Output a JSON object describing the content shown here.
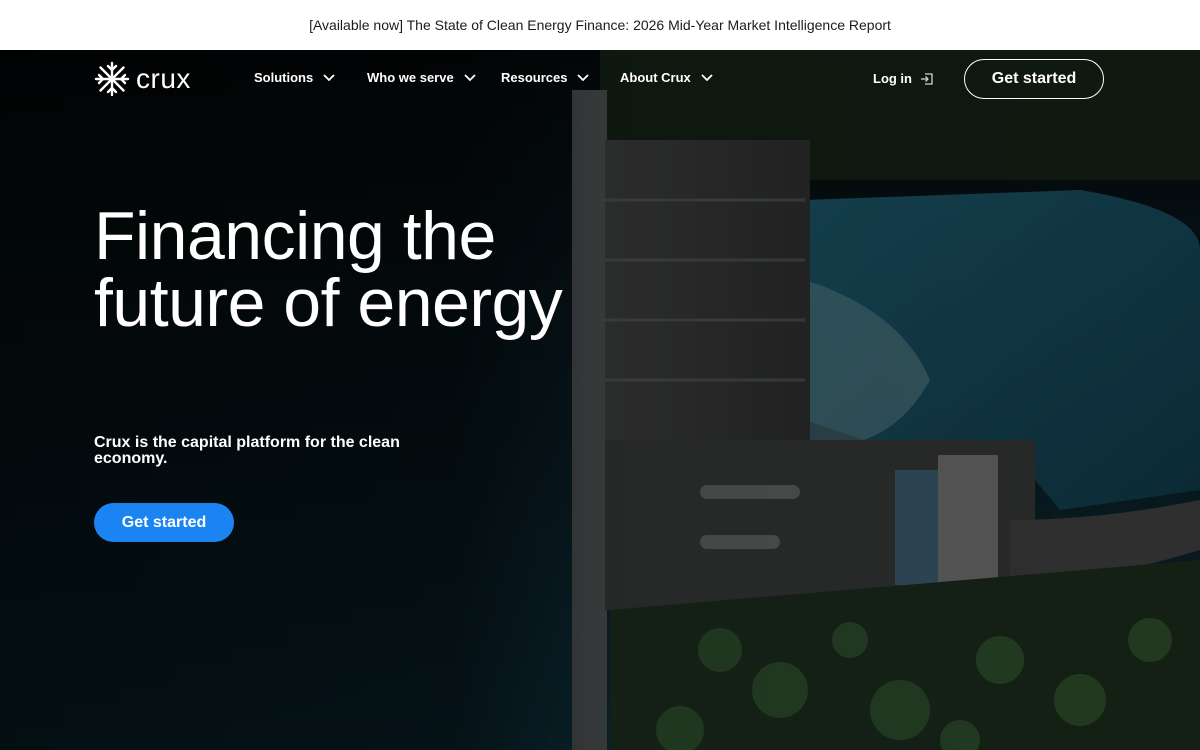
{
  "announcement": "[Available now] The State of Clean Energy Finance: 2026 Mid-Year Market Intelligence Report",
  "brand": {
    "name": "crux",
    "icon": "snowflake-logo-icon"
  },
  "nav": {
    "items": [
      {
        "label": "Solutions",
        "icon": "chevron-down-icon"
      },
      {
        "label": "Who we serve",
        "icon": "chevron-down-icon"
      },
      {
        "label": "Resources",
        "icon": "chevron-down-icon"
      },
      {
        "label": "About Crux",
        "icon": "chevron-down-icon"
      }
    ],
    "login": {
      "label": "Log in",
      "icon": "login-arrow-icon"
    },
    "cta": "Get started"
  },
  "hero": {
    "headline": "Financing the future of energy",
    "subhead": "Crux is the capital platform for the clean economy.",
    "cta": "Get started"
  },
  "colors": {
    "primary": "#1a85f2",
    "background": "#0b1418",
    "water": "#14424f",
    "banner": "#ffffff"
  }
}
